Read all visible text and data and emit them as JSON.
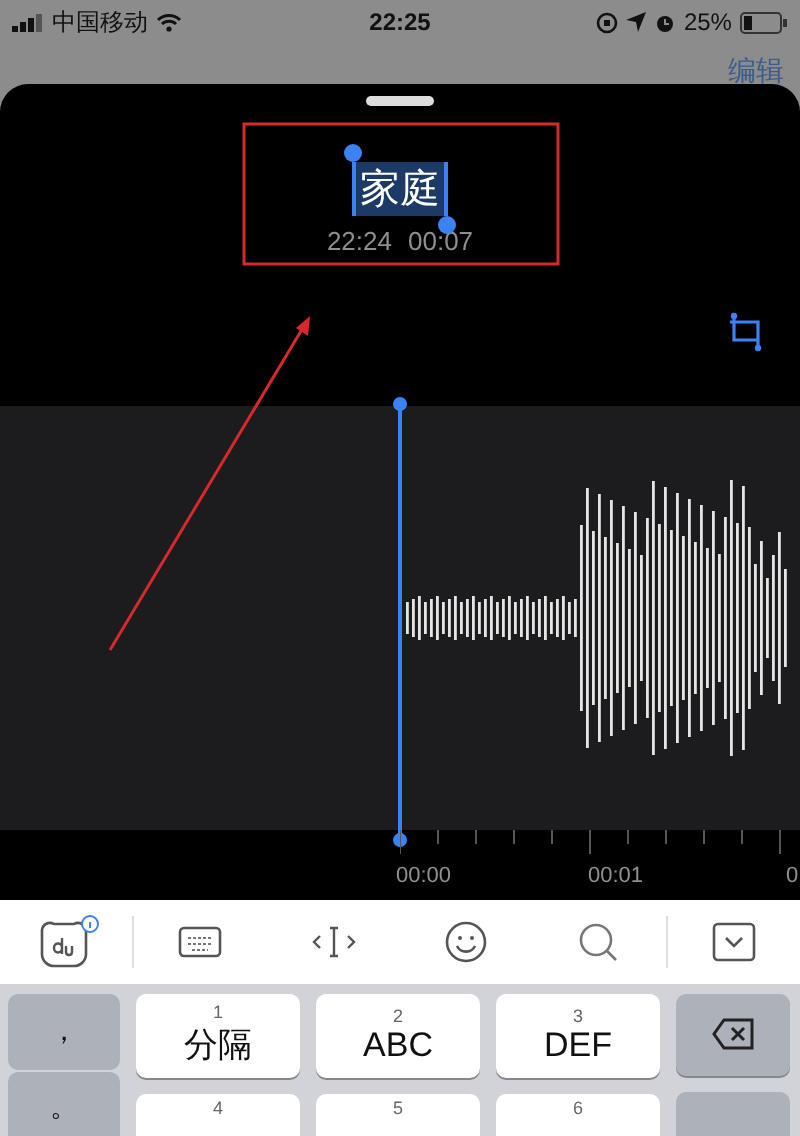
{
  "status_bar": {
    "carrier": "中国移动",
    "time": "22:25",
    "battery": "25%"
  },
  "header": {
    "edit": "编辑"
  },
  "recording": {
    "title": "家庭",
    "text_selected": true,
    "time": "22:24",
    "duration": "00:07"
  },
  "timeline": {
    "labels": [
      "00:00",
      "00:01",
      "0"
    ]
  },
  "keyboard": {
    "side_keys": [
      "，",
      "。"
    ],
    "keys": [
      {
        "kind": "letter",
        "number": "1",
        "label": "分隔"
      },
      {
        "kind": "letter",
        "number": "2",
        "label": "ABC"
      },
      {
        "kind": "letter",
        "number": "3",
        "label": "DEF"
      },
      {
        "kind": "delete"
      }
    ],
    "row2_numbers": [
      "4",
      "5",
      "6"
    ]
  }
}
